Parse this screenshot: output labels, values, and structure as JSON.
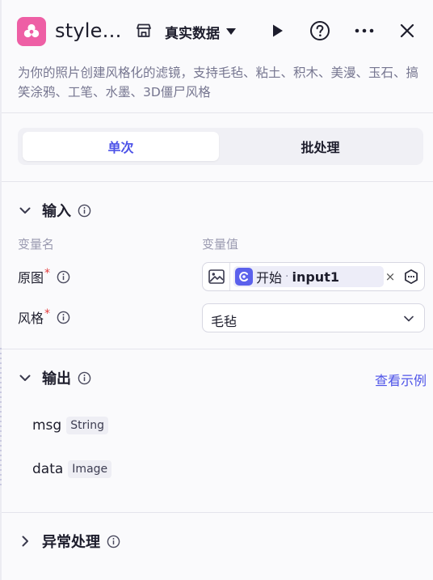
{
  "header": {
    "title": "style…",
    "data_source": "真实数据",
    "icons": [
      "flower-logo-icon",
      "store-icon",
      "caret-down-icon",
      "run-icon",
      "help-icon",
      "more-icon",
      "close-icon"
    ]
  },
  "description": "为你的照片创建风格化的滤镜，支持毛毡、粘土、积木、美漫、玉石、搞笑涂鸦、工笔、水墨、3D僵尸风格",
  "tabs": [
    {
      "label": "单次",
      "active": true
    },
    {
      "label": "批处理",
      "active": false
    }
  ],
  "input": {
    "title": "输入",
    "col_name": "变量名",
    "col_value": "变量值",
    "params": [
      {
        "label": "原图",
        "required_mark": "*",
        "ref_node": "开始",
        "ref_separator": "·",
        "ref_var": "input1",
        "clear": "×"
      },
      {
        "label": "风格",
        "required_mark": "*",
        "value": "毛毡"
      }
    ]
  },
  "output": {
    "title": "输出",
    "link": "查看示例",
    "fields": [
      {
        "name": "msg",
        "type": "String"
      },
      {
        "name": "data",
        "type": "Image"
      }
    ]
  },
  "exception": {
    "title": "异常处理"
  },
  "colors": {
    "accent": "#4d53e8",
    "logo": "#ee5fa5",
    "required": "#e33d3d"
  }
}
